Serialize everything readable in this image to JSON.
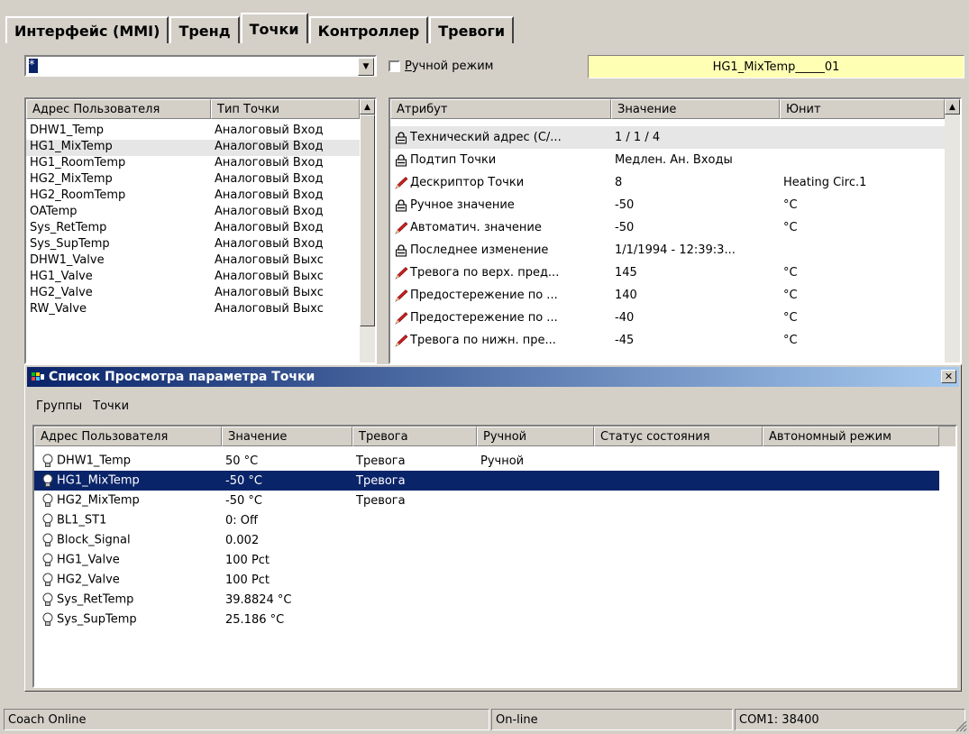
{
  "tabs": [
    "Интерфейс (MMI)",
    "Тренд",
    "Точки",
    "Контроллер",
    "Тревоги"
  ],
  "filter": {
    "value": "*"
  },
  "manual_mode": {
    "label_u": "Р",
    "label_rest": "учной режим",
    "checked": false
  },
  "selected_point_name": "HG1_MixTemp_____01",
  "points_list": {
    "headers": [
      "Адрес Пользователя",
      "Тип Точки"
    ],
    "rows": [
      [
        "DHW1_Temp",
        "Аналоговый Вход"
      ],
      [
        "HG1_MixTemp",
        "Аналоговый Вход"
      ],
      [
        "HG1_RoomTemp",
        "Аналоговый Вход"
      ],
      [
        "HG2_MixTemp",
        "Аналоговый Вход"
      ],
      [
        "HG2_RoomTemp",
        "Аналоговый Вход"
      ],
      [
        "OATemp",
        "Аналоговый Вход"
      ],
      [
        "Sys_RetTemp",
        "Аналоговый Вход"
      ],
      [
        "Sys_SupTemp",
        "Аналоговый Вход"
      ],
      [
        "DHW1_Valve",
        "Аналоговый Выхс"
      ],
      [
        "HG1_Valve",
        "Аналоговый Выхс"
      ],
      [
        "HG2_Valve",
        "Аналоговый Выхс"
      ],
      [
        "RW_Valve",
        "Аналоговый Выхс"
      ]
    ]
  },
  "attr_list": {
    "headers": [
      "Атрибут",
      "Значение",
      "Юнит"
    ],
    "rows": [
      {
        "icon": "lock",
        "attr": "Технический адрес (С/...",
        "value": "1 / 1 / 4",
        "unit": ""
      },
      {
        "icon": "lock",
        "attr": "Подтип Точки",
        "value": "Медлен. Ан. Входы",
        "unit": ""
      },
      {
        "icon": "pencil",
        "attr": "Дескриптор Точки",
        "value": "8",
        "unit": "Heating Circ.1"
      },
      {
        "icon": "lock",
        "attr": "Ручное значение",
        "value": "-50",
        "unit": "°C"
      },
      {
        "icon": "pencil",
        "attr": "Автоматич. значение",
        "value": "-50",
        "unit": "°C"
      },
      {
        "icon": "lock",
        "attr": "Последнее изменение",
        "value": "1/1/1994 - 12:39:3...",
        "unit": ""
      },
      {
        "icon": "pencil",
        "attr": "Тревога по верх. пред...",
        "value": "145",
        "unit": "°C"
      },
      {
        "icon": "pencil",
        "attr": "Предостережение по ...",
        "value": "140",
        "unit": "°C"
      },
      {
        "icon": "pencil",
        "attr": "Предостережение по ...",
        "value": "-40",
        "unit": "°C"
      },
      {
        "icon": "pencil",
        "attr": "Тревога по нижн. пре...",
        "value": "-45",
        "unit": "°C"
      }
    ]
  },
  "watch_window": {
    "title": "Список Просмотра параметра Точки",
    "menu": [
      "Группы",
      "Точки"
    ],
    "headers": [
      "Адрес Пользователя",
      "Значение",
      "Тревога",
      "Ручной",
      "Статус состояния",
      "Автономный режим"
    ],
    "rows": [
      [
        "DHW1_Temp",
        "50 °C",
        "Тревога",
        "Ручной"
      ],
      [
        "HG1_MixTemp",
        "-50 °C",
        "Тревога",
        ""
      ],
      [
        "HG2_MixTemp",
        "-50 °C",
        "Тревога",
        ""
      ],
      [
        "BL1_ST1",
        "0: Off",
        "",
        ""
      ],
      [
        "Block_Signal",
        "0.002",
        "",
        ""
      ],
      [
        "HG1_Valve",
        "100 Pct",
        "",
        ""
      ],
      [
        "HG2_Valve",
        "100 Pct",
        "",
        ""
      ],
      [
        "Sys_RetTemp",
        "39.8824 °C",
        "",
        ""
      ],
      [
        "Sys_SupTemp",
        "25.186 °C",
        "",
        ""
      ]
    ]
  },
  "status_bar": [
    "Coach Online",
    "On-line",
    "COM1: 38400"
  ],
  "colors": {
    "selection": "#0a246a",
    "yellow_field": "#ffffb4",
    "face": "#d4d0c8"
  }
}
